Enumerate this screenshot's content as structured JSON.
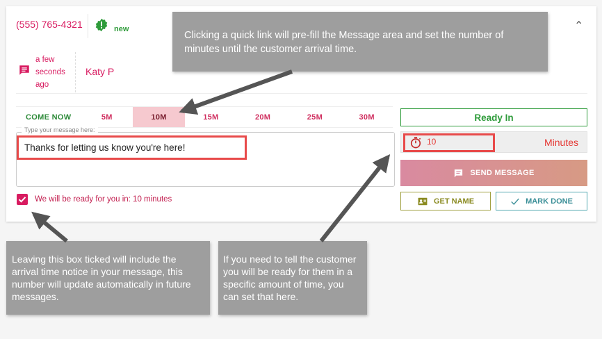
{
  "header": {
    "phone": "(555) 765-4321",
    "status": "new",
    "time_ago": "a few seconds ago",
    "agent": "Katy P"
  },
  "quick_links": [
    "COME NOW",
    "5M",
    "10M",
    "15M",
    "20M",
    "25M",
    "30M"
  ],
  "quick_links_active": "10M",
  "message": {
    "label": "Type your message here:",
    "value": "Thanks for letting us know you're here!"
  },
  "checkbox": {
    "checked": true,
    "label": "We will be ready for you in: 10 minutes"
  },
  "ready": {
    "label": "Ready In",
    "minutes_value": "10",
    "minutes_unit": "Minutes"
  },
  "buttons": {
    "send": "SEND MESSAGE",
    "get_name": "GET NAME",
    "mark_done": "MARK DONE"
  },
  "callouts": {
    "top": "Clicking a quick link will pre-fill the Message area and set the number of minutes until the customer arrival time.",
    "left": "Leaving this box ticked will include the arrival time notice in your message, this number will update automatically in future messages.",
    "right": "If you need to tell the customer you will be ready for them in a specific amount of time, you can set that here."
  },
  "icons": {
    "status": "alert-badge-icon",
    "message": "chat-bubble-icon",
    "collapse": "chevron-up-icon",
    "timer": "timer-icon",
    "send": "message-icon",
    "get_name": "contact-card-icon",
    "mark_done": "check-icon"
  },
  "colors": {
    "brand": "#d81b60",
    "success": "#2e9b3a",
    "callout": "#9e9e9e",
    "highlight": "#e84a4a"
  }
}
